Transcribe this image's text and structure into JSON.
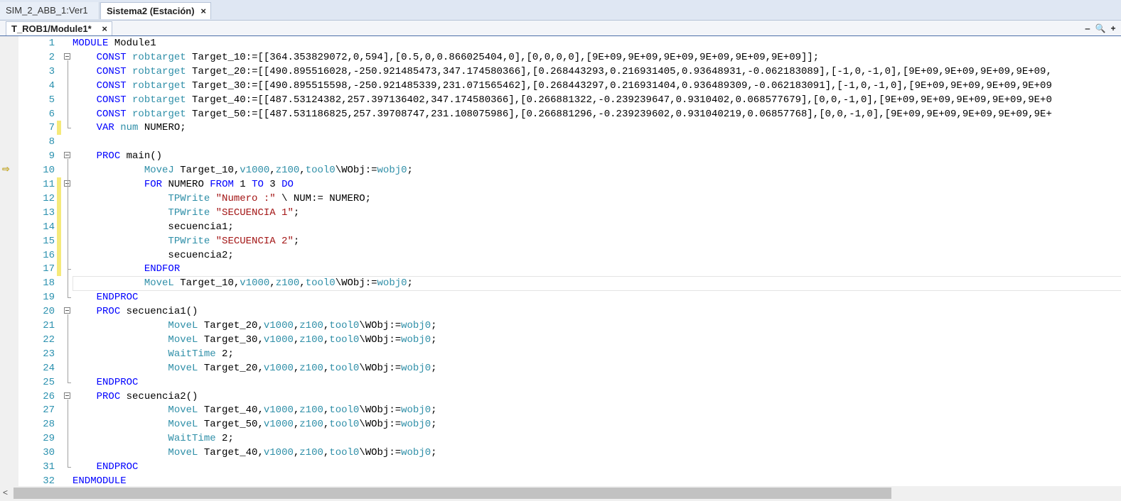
{
  "doc_tabs": [
    {
      "label": "SIM_2_ABB_1:Ver1"
    },
    {
      "label": "Sistema2 (Estación)",
      "close": "×"
    }
  ],
  "editor_tab": {
    "label": "T_ROB1/Module1*",
    "close": "×"
  },
  "window_buttons": [
    "‒",
    "🔍",
    "+"
  ],
  "execution_pointer_line": 10,
  "changed_lines": [
    7,
    11,
    12,
    13,
    14,
    15,
    16,
    17
  ],
  "current_line": 18,
  "code_lines": [
    {
      "n": "1",
      "tokens": [
        [
          "kw",
          "MODULE"
        ],
        [
          "t",
          " Module1"
        ]
      ]
    },
    {
      "n": "2",
      "tokens": [
        [
          "t",
          "    "
        ],
        [
          "kw",
          "CONST"
        ],
        [
          "t",
          " "
        ],
        [
          "ty",
          "robtarget"
        ],
        [
          "t",
          " Target_10:=[[364.353829072,0,594],[0.5,0,0.866025404,0],[0,0,0,0],[9E+09,9E+09,9E+09,9E+09,9E+09,9E+09]];"
        ]
      ]
    },
    {
      "n": "3",
      "tokens": [
        [
          "t",
          "    "
        ],
        [
          "kw",
          "CONST"
        ],
        [
          "t",
          " "
        ],
        [
          "ty",
          "robtarget"
        ],
        [
          "t",
          " Target_20:=[[490.895516028,-250.921485473,347.174580366],[0.268443293,0.216931405,0.93648931,-0.062183089],[-1,0,-1,0],[9E+09,9E+09,9E+09,9E+09,"
        ]
      ]
    },
    {
      "n": "4",
      "tokens": [
        [
          "t",
          "    "
        ],
        [
          "kw",
          "CONST"
        ],
        [
          "t",
          " "
        ],
        [
          "ty",
          "robtarget"
        ],
        [
          "t",
          " Target_30:=[[490.895515598,-250.921485339,231.071565462],[0.268443297,0.216931404,0.936489309,-0.062183091],[-1,0,-1,0],[9E+09,9E+09,9E+09,9E+09"
        ]
      ]
    },
    {
      "n": "5",
      "tokens": [
        [
          "t",
          "    "
        ],
        [
          "kw",
          "CONST"
        ],
        [
          "t",
          " "
        ],
        [
          "ty",
          "robtarget"
        ],
        [
          "t",
          " Target_40:=[[487.53124382,257.397136402,347.174580366],[0.266881322,-0.239239647,0.9310402,0.068577679],[0,0,-1,0],[9E+09,9E+09,9E+09,9E+09,9E+0"
        ]
      ]
    },
    {
      "n": "6",
      "tokens": [
        [
          "t",
          "    "
        ],
        [
          "kw",
          "CONST"
        ],
        [
          "t",
          " "
        ],
        [
          "ty",
          "robtarget"
        ],
        [
          "t",
          " Target_50:=[[487.531186825,257.39708747,231.108075986],[0.266881296,-0.239239602,0.931040219,0.06857768],[0,0,-1,0],[9E+09,9E+09,9E+09,9E+09,9E+"
        ]
      ]
    },
    {
      "n": "7",
      "tokens": [
        [
          "t",
          "    "
        ],
        [
          "kw",
          "VAR"
        ],
        [
          "t",
          " "
        ],
        [
          "ty",
          "num"
        ],
        [
          "t",
          " NUMERO;"
        ]
      ]
    },
    {
      "n": "8",
      "tokens": []
    },
    {
      "n": "9",
      "tokens": [
        [
          "t",
          "    "
        ],
        [
          "kw",
          "PROC"
        ],
        [
          "t",
          " main()"
        ]
      ]
    },
    {
      "n": "10",
      "tokens": [
        [
          "t",
          "            "
        ],
        [
          "fn",
          "MoveJ"
        ],
        [
          "t",
          " Target_10,"
        ],
        [
          "fn",
          "v1000"
        ],
        [
          "t",
          ","
        ],
        [
          "fn",
          "z100"
        ],
        [
          "t",
          ","
        ],
        [
          "fn",
          "tool0"
        ],
        [
          "t",
          "\\WObj:="
        ],
        [
          "fn",
          "wobj0"
        ],
        [
          "t",
          ";"
        ]
      ]
    },
    {
      "n": "11",
      "tokens": [
        [
          "t",
          "            "
        ],
        [
          "kw",
          "FOR"
        ],
        [
          "t",
          " NUMERO "
        ],
        [
          "kw",
          "FROM"
        ],
        [
          "t",
          " 1 "
        ],
        [
          "kw",
          "TO"
        ],
        [
          "t",
          " 3 "
        ],
        [
          "kw",
          "DO"
        ]
      ]
    },
    {
      "n": "12",
      "tokens": [
        [
          "t",
          "                "
        ],
        [
          "fn",
          "TPWrite"
        ],
        [
          "t",
          " "
        ],
        [
          "st",
          "\"Numero :\""
        ],
        [
          "t",
          " \\ NUM:= NUMERO;"
        ]
      ]
    },
    {
      "n": "13",
      "tokens": [
        [
          "t",
          "                "
        ],
        [
          "fn",
          "TPWrite"
        ],
        [
          "t",
          " "
        ],
        [
          "st",
          "\"SECUENCIA 1\""
        ],
        [
          "t",
          ";"
        ]
      ]
    },
    {
      "n": "14",
      "tokens": [
        [
          "t",
          "                secuencia1;"
        ]
      ]
    },
    {
      "n": "15",
      "tokens": [
        [
          "t",
          "                "
        ],
        [
          "fn",
          "TPWrite"
        ],
        [
          "t",
          " "
        ],
        [
          "st",
          "\"SECUENCIA 2\""
        ],
        [
          "t",
          ";"
        ]
      ]
    },
    {
      "n": "16",
      "tokens": [
        [
          "t",
          "                secuencia2;"
        ]
      ]
    },
    {
      "n": "17",
      "tokens": [
        [
          "t",
          "            "
        ],
        [
          "kw",
          "ENDFOR"
        ]
      ]
    },
    {
      "n": "18",
      "tokens": [
        [
          "t",
          "            "
        ],
        [
          "fn",
          "MoveL"
        ],
        [
          "t",
          " Target_10,"
        ],
        [
          "fn",
          "v1000"
        ],
        [
          "t",
          ","
        ],
        [
          "fn",
          "z100"
        ],
        [
          "t",
          ","
        ],
        [
          "fn",
          "tool0"
        ],
        [
          "t",
          "\\WObj:="
        ],
        [
          "fn",
          "wobj0"
        ],
        [
          "t",
          ";"
        ]
      ]
    },
    {
      "n": "19",
      "tokens": [
        [
          "t",
          "    "
        ],
        [
          "kw",
          "ENDPROC"
        ]
      ]
    },
    {
      "n": "20",
      "tokens": [
        [
          "t",
          "    "
        ],
        [
          "kw",
          "PROC"
        ],
        [
          "t",
          " secuencia1()"
        ]
      ]
    },
    {
      "n": "21",
      "tokens": [
        [
          "t",
          "                "
        ],
        [
          "fn",
          "MoveL"
        ],
        [
          "t",
          " Target_20,"
        ],
        [
          "fn",
          "v1000"
        ],
        [
          "t",
          ","
        ],
        [
          "fn",
          "z100"
        ],
        [
          "t",
          ","
        ],
        [
          "fn",
          "tool0"
        ],
        [
          "t",
          "\\WObj:="
        ],
        [
          "fn",
          "wobj0"
        ],
        [
          "t",
          ";"
        ]
      ]
    },
    {
      "n": "22",
      "tokens": [
        [
          "t",
          "                "
        ],
        [
          "fn",
          "MoveL"
        ],
        [
          "t",
          " Target_30,"
        ],
        [
          "fn",
          "v1000"
        ],
        [
          "t",
          ","
        ],
        [
          "fn",
          "z100"
        ],
        [
          "t",
          ","
        ],
        [
          "fn",
          "tool0"
        ],
        [
          "t",
          "\\WObj:="
        ],
        [
          "fn",
          "wobj0"
        ],
        [
          "t",
          ";"
        ]
      ]
    },
    {
      "n": "23",
      "tokens": [
        [
          "t",
          "                "
        ],
        [
          "fn",
          "WaitTime"
        ],
        [
          "t",
          " 2;"
        ]
      ]
    },
    {
      "n": "24",
      "tokens": [
        [
          "t",
          "                "
        ],
        [
          "fn",
          "MoveL"
        ],
        [
          "t",
          " Target_20,"
        ],
        [
          "fn",
          "v1000"
        ],
        [
          "t",
          ","
        ],
        [
          "fn",
          "z100"
        ],
        [
          "t",
          ","
        ],
        [
          "fn",
          "tool0"
        ],
        [
          "t",
          "\\WObj:="
        ],
        [
          "fn",
          "wobj0"
        ],
        [
          "t",
          ";"
        ]
      ]
    },
    {
      "n": "25",
      "tokens": [
        [
          "t",
          "    "
        ],
        [
          "kw",
          "ENDPROC"
        ]
      ]
    },
    {
      "n": "26",
      "tokens": [
        [
          "t",
          "    "
        ],
        [
          "kw",
          "PROC"
        ],
        [
          "t",
          " secuencia2()"
        ]
      ]
    },
    {
      "n": "27",
      "tokens": [
        [
          "t",
          "                "
        ],
        [
          "fn",
          "MoveL"
        ],
        [
          "t",
          " Target_40,"
        ],
        [
          "fn",
          "v1000"
        ],
        [
          "t",
          ","
        ],
        [
          "fn",
          "z100"
        ],
        [
          "t",
          ","
        ],
        [
          "fn",
          "tool0"
        ],
        [
          "t",
          "\\WObj:="
        ],
        [
          "fn",
          "wobj0"
        ],
        [
          "t",
          ";"
        ]
      ]
    },
    {
      "n": "28",
      "tokens": [
        [
          "t",
          "                "
        ],
        [
          "fn",
          "MoveL"
        ],
        [
          "t",
          " Target_50,"
        ],
        [
          "fn",
          "v1000"
        ],
        [
          "t",
          ","
        ],
        [
          "fn",
          "z100"
        ],
        [
          "t",
          ","
        ],
        [
          "fn",
          "tool0"
        ],
        [
          "t",
          "\\WObj:="
        ],
        [
          "fn",
          "wobj0"
        ],
        [
          "t",
          ";"
        ]
      ]
    },
    {
      "n": "29",
      "tokens": [
        [
          "t",
          "                "
        ],
        [
          "fn",
          "WaitTime"
        ],
        [
          "t",
          " 2;"
        ]
      ]
    },
    {
      "n": "30",
      "tokens": [
        [
          "t",
          "                "
        ],
        [
          "fn",
          "MoveL"
        ],
        [
          "t",
          " Target_40,"
        ],
        [
          "fn",
          "v1000"
        ],
        [
          "t",
          ","
        ],
        [
          "fn",
          "z100"
        ],
        [
          "t",
          ","
        ],
        [
          "fn",
          "tool0"
        ],
        [
          "t",
          "\\WObj:="
        ],
        [
          "fn",
          "wobj0"
        ],
        [
          "t",
          ";"
        ]
      ]
    },
    {
      "n": "31",
      "tokens": [
        [
          "t",
          "    "
        ],
        [
          "kw",
          "ENDPROC"
        ]
      ]
    },
    {
      "n": "32",
      "tokens": [
        [
          "kw",
          "ENDMODULE"
        ]
      ]
    }
  ],
  "colors": {
    "keyword": "#0000ff",
    "type": "#2f8fa8",
    "string": "#a31515",
    "line_number": "#2b91af",
    "changed_marker": "#f5e97a"
  },
  "scrollbar": {
    "left_arrow": "<"
  }
}
